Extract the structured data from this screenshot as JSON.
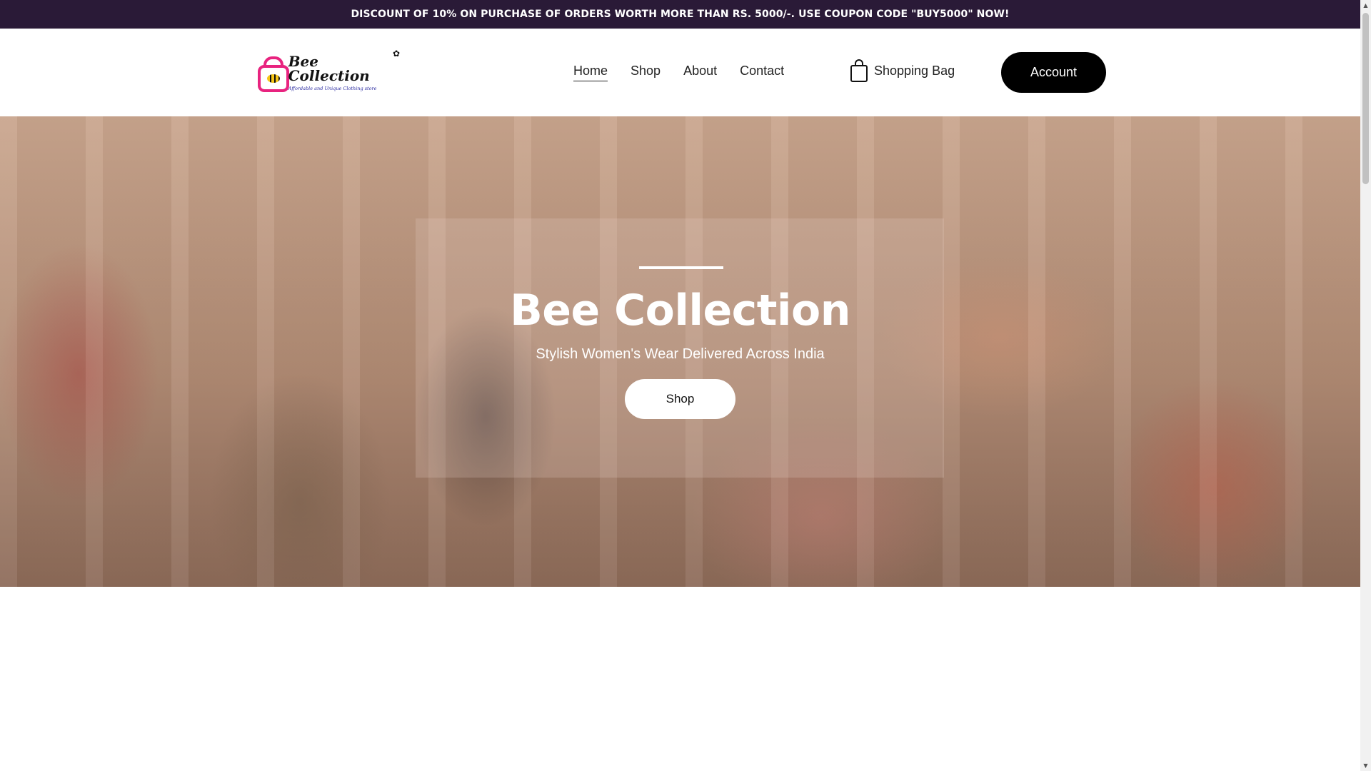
{
  "announcement": "DISCOUNT OF 10% ON PURCHASE OF ORDERS WORTH MORE THAN RS. 5000/-. USE COUPON CODE \"BUY5000\" NOW!",
  "logo": {
    "title": "Bee Collection",
    "tagline": "Affordable and Unique Clothing store",
    "brand_color": "#e8237f"
  },
  "nav": {
    "items": [
      {
        "label": "Home",
        "active": true
      },
      {
        "label": "Shop",
        "active": false
      },
      {
        "label": "About",
        "active": false
      },
      {
        "label": "Contact",
        "active": false
      }
    ]
  },
  "cart": {
    "label": "Shopping Bag",
    "icon": "shopping-bag-icon"
  },
  "account": {
    "label": "Account"
  },
  "hero": {
    "title": "Bee Collection",
    "subtitle": "Stylish Women's Wear Delivered Across India",
    "cta_label": "Shop"
  },
  "colors": {
    "announcement_bg": "#2a1a37",
    "account_bg": "#000000",
    "hero_text": "#ffffff"
  }
}
